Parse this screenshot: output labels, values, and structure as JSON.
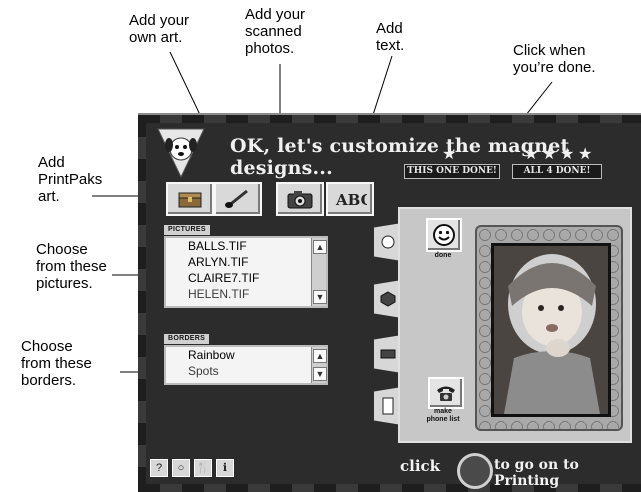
{
  "callouts": {
    "add_art": "Add your\nown art.",
    "add_photos": "Add your\nscanned\nphotos.",
    "add_text": "Add\ntext.",
    "done": "Click when\nyou’re done.",
    "printpaks": "Add\nPrintPaks\nart.",
    "pictures": "Choose\nfrom these\npictures.",
    "borders": "Choose\nfrom these\nborders."
  },
  "app": {
    "headline": "OK, let's customize the magnet designs...",
    "badges": {
      "this_one_done": "THIS ONE DONE!",
      "all_4_done": "ALL 4 DONE!"
    },
    "pictures_label": "PICTURES",
    "pictures": [
      "BALLS.TIF",
      "ARLYN.TIF",
      "CLAIRE7.TIF",
      "HELEN.TIF"
    ],
    "borders_label": "BORDERS",
    "borders": [
      "Rainbow",
      "Spots"
    ],
    "done_label": "done",
    "phone_label": "make\nphone list",
    "go_prefix": "click",
    "go_suffix": "to go on to Printing",
    "bottom_icons": [
      "?",
      "○",
      "🍴",
      "ℹ"
    ]
  }
}
